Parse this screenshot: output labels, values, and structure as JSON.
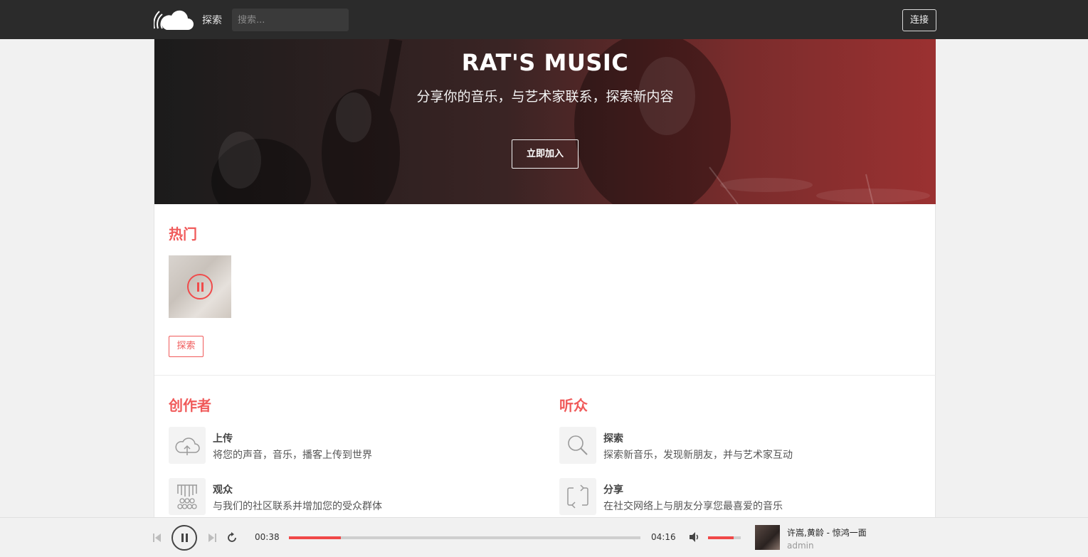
{
  "nav": {
    "explore_label": "探索",
    "search_placeholder": "搜索...",
    "connect_label": "连接"
  },
  "hero": {
    "title": "RAT'S MUSIC",
    "subtitle": "分享你的音乐，与艺术家联系，探索新内容",
    "join_label": "立即加入"
  },
  "hot": {
    "title": "热门",
    "explore_label": "探索"
  },
  "creators": {
    "title": "创作者",
    "items": [
      {
        "title": "上传",
        "desc": "将您的声音，音乐，播客上传到世界",
        "icon": "cloud-upload-icon"
      },
      {
        "title": "观众",
        "desc": "与我们的社区联系并增加您的受众群体",
        "icon": "audience-icon"
      }
    ]
  },
  "listeners": {
    "title": "听众",
    "items": [
      {
        "title": "探索",
        "desc": "探索新音乐，发现新朋友，并与艺术家互动",
        "icon": "search-icon"
      },
      {
        "title": "分享",
        "desc": "在社交网络上与朋友分享您最喜爱的音乐",
        "icon": "share-icon"
      }
    ]
  },
  "player": {
    "current_time": "00:38",
    "total_time": "04:16",
    "progress": 0.148,
    "volume": 0.78,
    "song": "许嵩,黄龄 - 惊鸿一面",
    "user": "admin"
  },
  "colors": {
    "accent": "#f05a5a",
    "topbar": "#2b2b2b"
  }
}
